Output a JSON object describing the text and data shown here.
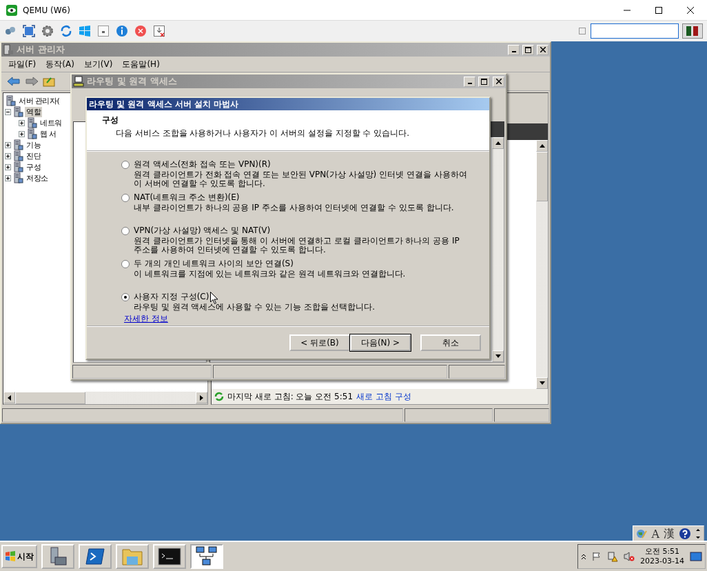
{
  "host_window": {
    "title": "QEMU (W6)",
    "checkbox": {
      "checked": false
    }
  },
  "server_manager": {
    "title": "서버 관리자",
    "menu": [
      "파일(F)",
      "동작(A)",
      "보기(V)",
      "도움말(H)"
    ],
    "tree": [
      {
        "label": "서버 관리자(",
        "selected": false,
        "children": [
          {
            "label": "역할",
            "expanded": true,
            "selected": true,
            "children": [
              {
                "label": "네트워",
                "expanded": false,
                "selected": false
              },
              {
                "label": "웹 서",
                "expanded": false,
                "selected": false
              }
            ]
          },
          {
            "label": "기능",
            "expanded": false,
            "selected": false
          },
          {
            "label": "진단",
            "expanded": false,
            "selected": false
          },
          {
            "label": "구성",
            "expanded": false,
            "selected": false
          },
          {
            "label": "저장소",
            "expanded": false,
            "selected": false
          }
        ]
      }
    ],
    "refresh": {
      "text": "마지막 새로 고침: 오늘 오전 5:51",
      "link": "새로 고침 구성"
    }
  },
  "routing_window": {
    "title": "라우팅 및 원격 액세스"
  },
  "wizard": {
    "title": "라우팅 및 원격 액세스 서버 설치 마법사",
    "header": {
      "title": "구성",
      "subtitle": "다음 서비스 조합을 사용하거나 사용자가 이 서버의 설정을 지정할 수 있습니다."
    },
    "options": [
      {
        "label": "원격 액세스(전화 접속 또는 VPN)(R)",
        "description": "원격 클라이언트가 전화 접속 연결 또는 보안된 VPN(가상 사설망) 인터넷 연결을 사용하여\n이 서버에 연결할 수 있도록 합니다.",
        "selected": false
      },
      {
        "label": "NAT(네트워크 주소 변환)(E)",
        "description": "내부 클라이언트가 하나의 공용 IP 주소를 사용하여 인터넷에 연결할 수 있도록 합니다.",
        "selected": false
      },
      {
        "label": "VPN(가상 사설망) 액세스 및 NAT(V)",
        "description": "원격 클라이언트가 인터넷을 통해 이 서버에 연결하고 로컬 클라이언트가 하나의 공용 IP\n주소를 사용하여 인터넷에 연결할 수 있도록 합니다.",
        "selected": false
      },
      {
        "label": "두 개의 개인 네트워크 사이의 보안 연결(S)",
        "description": "이 네트워크를 지점에 있는 네트워크와 같은 원격 네트워크와 연결합니다.",
        "selected": false
      },
      {
        "label": "사용자 지정 구성(C)",
        "description": "라우팅 및 원격 액세스에 사용할 수 있는 기능 조합을 선택합니다.",
        "selected": true
      }
    ],
    "link": "자세한 정보",
    "buttons": [
      {
        "label": "< 뒤로(B)",
        "default": false
      },
      {
        "label": "다음(N) >",
        "default": true
      },
      {
        "label": "취소",
        "default": false
      }
    ]
  },
  "language_bar": [
    "A",
    "漢"
  ],
  "taskbar": {
    "start": "시작",
    "apps": [
      {
        "kind": "server",
        "selected": false
      },
      {
        "kind": "shell",
        "selected": false
      },
      {
        "kind": "folder",
        "selected": false
      },
      {
        "kind": "console",
        "selected": false
      },
      {
        "kind": "network",
        "selected": true
      }
    ],
    "clock": {
      "time": "오전 5:51",
      "date": "2023-03-14"
    }
  }
}
